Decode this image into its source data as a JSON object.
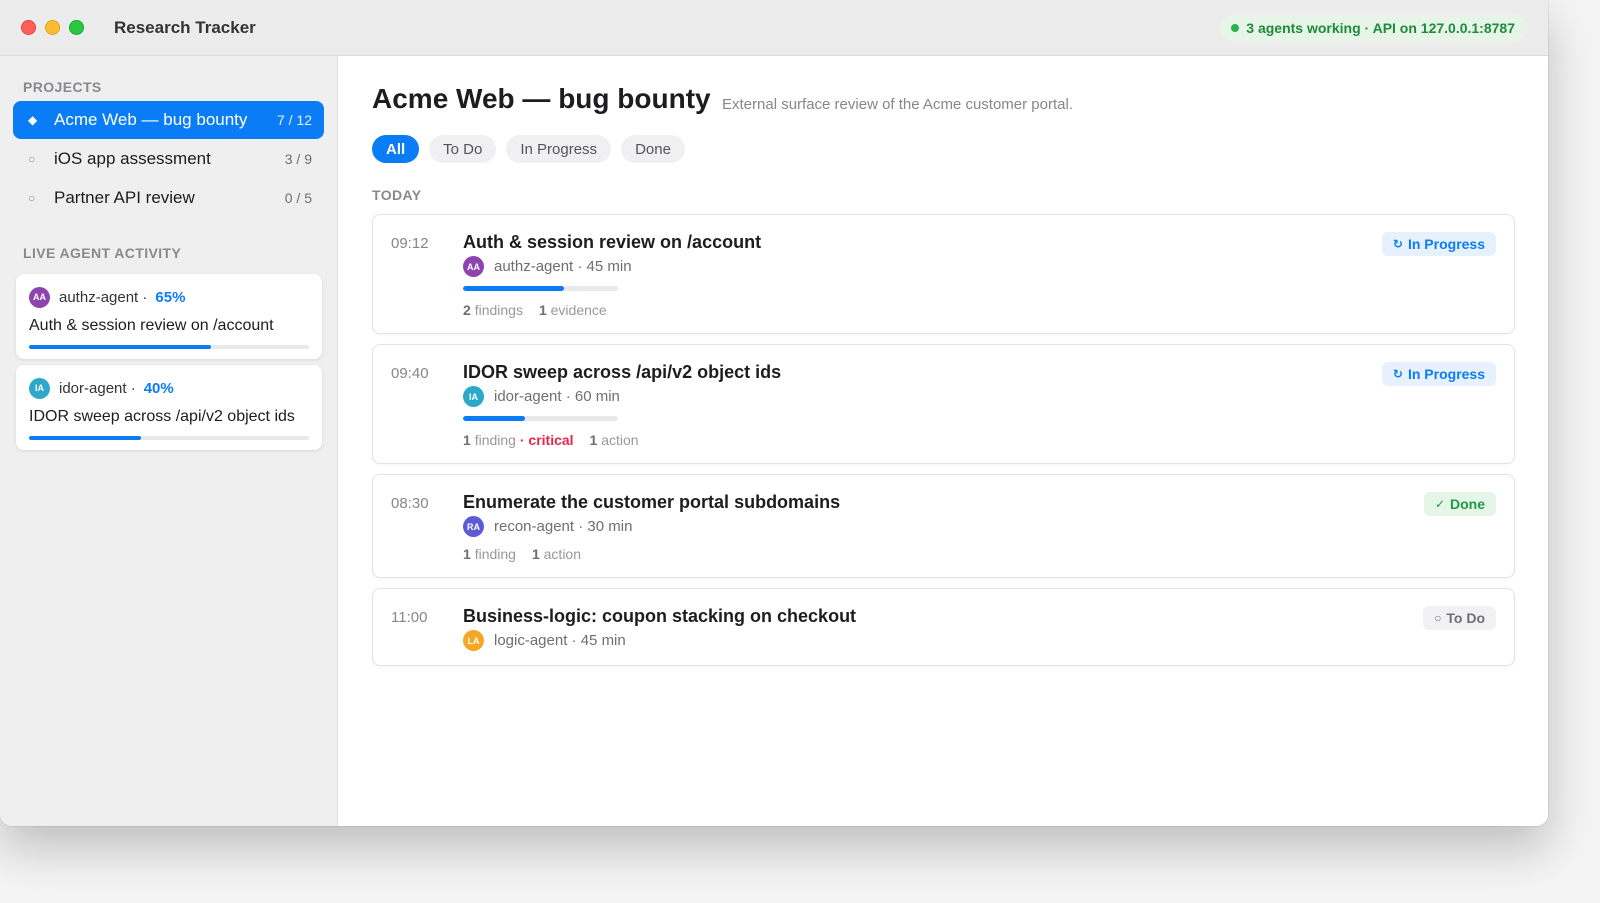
{
  "window": {
    "title": "Research Tracker",
    "api_status": "3 agents working · API on 127.0.0.1:8787"
  },
  "sidebar": {
    "projects_label": "PROJECTS",
    "projects": [
      {
        "name": "Acme Web — bug bounty",
        "count": "7 / 12",
        "active": true,
        "bullet": "◆"
      },
      {
        "name": "iOS app assessment",
        "count": "3 / 9",
        "active": false,
        "bullet": "○"
      },
      {
        "name": "Partner API review",
        "count": "0 / 5",
        "active": false,
        "bullet": "○"
      }
    ],
    "activity_label": "LIVE AGENT ACTIVITY",
    "activity": [
      {
        "initials": "AA",
        "agent": "authz-agent ·",
        "percent": "65%",
        "progress": 0.65,
        "task": "Auth & session review on /account",
        "color": "#8e44ad"
      },
      {
        "initials": "IA",
        "agent": "idor-agent ·",
        "percent": "40%",
        "progress": 0.4,
        "task": "IDOR sweep across /api/v2 object ids",
        "color": "#2ea8c9"
      }
    ]
  },
  "main": {
    "title": "Acme Web — bug bounty",
    "subtitle": "External surface review of the Acme customer portal.",
    "filters": [
      {
        "label": "All",
        "active": true
      },
      {
        "label": "To Do",
        "active": false
      },
      {
        "label": "In Progress",
        "active": false
      },
      {
        "label": "Done",
        "active": false
      }
    ],
    "group_label": "TODAY",
    "tasks": [
      {
        "time": "09:12",
        "title": "Auth & session review on /account",
        "initials": "AA",
        "agent_color": "#8e44ad",
        "meta": "authz-agent · 45 min",
        "progress": 0.65,
        "stats": [
          {
            "num": "2",
            "text": "findings"
          },
          {
            "num": "1",
            "text": "evidence"
          }
        ],
        "status": "In Progress",
        "status_icon": "↻"
      },
      {
        "time": "09:40",
        "title": "IDOR sweep across /api/v2 object ids",
        "initials": "IA",
        "agent_color": "#2ea8c9",
        "meta": "idor-agent · 60 min",
        "progress": 0.4,
        "stats": [
          {
            "num": "1",
            "text": "finding",
            "sep": " · ",
            "extra": "critical"
          },
          {
            "num": "1",
            "text": "action"
          }
        ],
        "status": "In Progress",
        "status_icon": "↻"
      },
      {
        "time": "08:30",
        "title": "Enumerate the customer portal subdomains",
        "initials": "RA",
        "agent_color": "#5b5bd6",
        "meta": "recon-agent · 30 min",
        "stats": [
          {
            "num": "1",
            "text": "finding"
          },
          {
            "num": "1",
            "text": "action"
          }
        ],
        "status": "Done",
        "status_icon": "✓"
      },
      {
        "time": "11:00",
        "title": "Business-logic: coupon stacking on checkout",
        "initials": "LA",
        "agent_color": "#f5a623",
        "meta": "logic-agent · 45 min",
        "status": "To Do",
        "status_icon": "○"
      }
    ]
  }
}
